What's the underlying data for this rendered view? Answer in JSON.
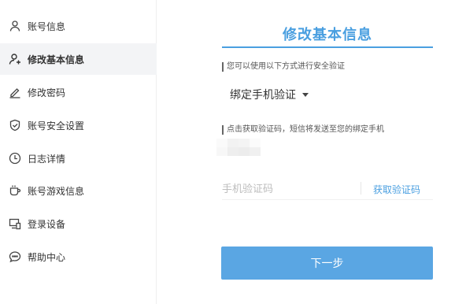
{
  "sidebar": {
    "items": [
      {
        "label": "账号信息",
        "icon": "user-icon"
      },
      {
        "label": "修改基本信息",
        "icon": "user-edit-icon"
      },
      {
        "label": "修改密码",
        "icon": "pen-icon"
      },
      {
        "label": "账号安全设置",
        "icon": "shield-icon"
      },
      {
        "label": "日志详情",
        "icon": "clock-icon"
      },
      {
        "label": "账号游戏信息",
        "icon": "cup-icon"
      },
      {
        "label": "登录设备",
        "icon": "device-icon"
      },
      {
        "label": "帮助中心",
        "icon": "chat-icon"
      }
    ],
    "active_index": 1
  },
  "main": {
    "title": "修改基本信息",
    "hint_methods": "您可以使用以下方式进行安全验证",
    "verify_method": "绑定手机验证",
    "hint_code": "点击获取验证码，短信将发送至您的绑定手机",
    "code_placeholder": "手机验证码",
    "get_code_label": "获取验证码",
    "next_label": "下一步"
  },
  "colors": {
    "accent": "#4a9fe0",
    "button": "#5aa6e3",
    "active_bg": "#f3f4f6"
  }
}
